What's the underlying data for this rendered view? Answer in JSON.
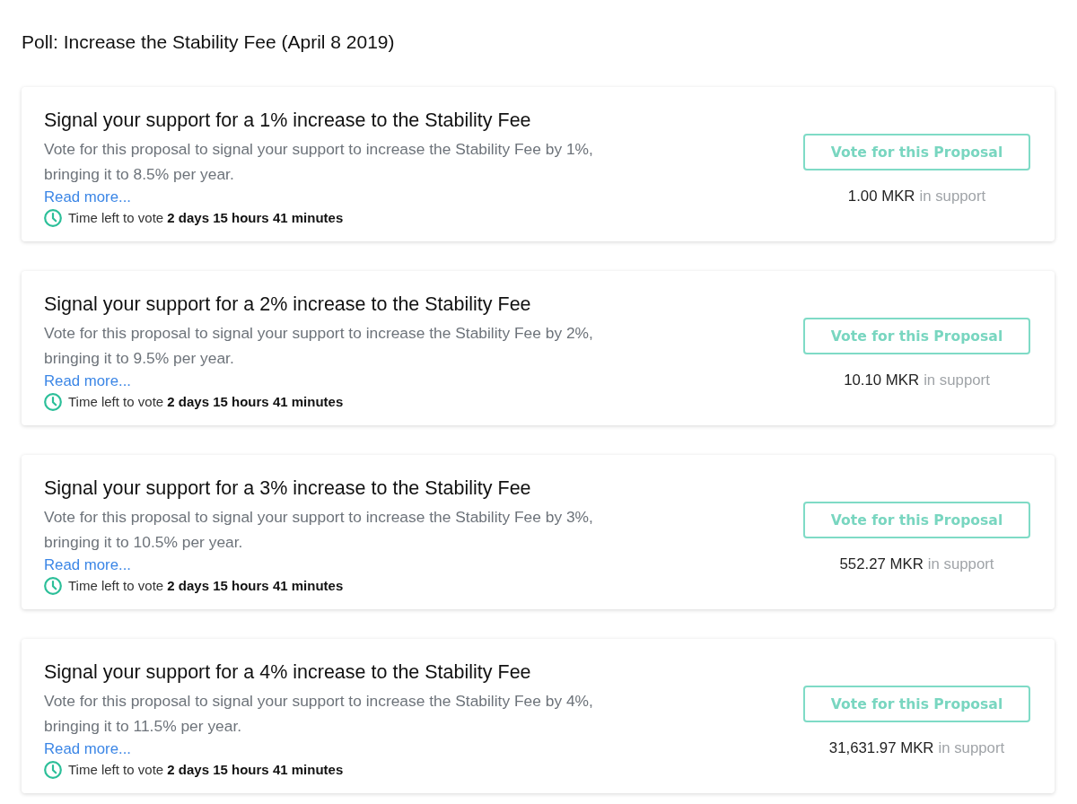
{
  "page": {
    "title": "Poll: Increase the Stability Fee (April 8 2019)"
  },
  "proposals": [
    {
      "title": "Signal your support for a 1% increase to the Stability Fee",
      "description": "Vote for this proposal to signal your support to increase the Stability Fee by 1%, bringing it to 8.5% per year.",
      "read_more": "Read more...",
      "time_left": "Time left to vote **2 days 15 hours 41 minutes**",
      "vote_button": "Vote for this Proposal",
      "support_amount": "1.00 MKR",
      "support_label": "in support"
    },
    {
      "title": "Signal your support for a 2% increase to the Stability Fee",
      "description": "Vote for this proposal to signal your support to increase the Stability Fee by 2%, bringing it to 9.5% per year.",
      "read_more": "Read more...",
      "time_left": "Time left to vote **2 days 15 hours 41 minutes**",
      "vote_button": "Vote for this Proposal",
      "support_amount": "10.10 MKR",
      "support_label": "in support"
    },
    {
      "title": "Signal your support for a 3% increase to the Stability Fee",
      "description": "Vote for this proposal to signal your support to increase the Stability Fee by 3%, bringing it to 10.5% per year.",
      "read_more": "Read more...",
      "time_left": "Time left to vote **2 days 15 hours 41 minutes**",
      "vote_button": "Vote for this Proposal",
      "support_amount": "552.27 MKR",
      "support_label": "in support"
    },
    {
      "title": "Signal your support for a 4% increase to the Stability Fee",
      "description": "Vote for this proposal to signal your support to increase the Stability Fee by 4%, bringing it to 11.5% per year.",
      "read_more": "Read more...",
      "time_left": "Time left to vote **2 days 15 hours 41 minutes**",
      "vote_button": "Vote for this Proposal",
      "support_amount": "31,631.97 MKR",
      "support_label": "in support"
    }
  ]
}
